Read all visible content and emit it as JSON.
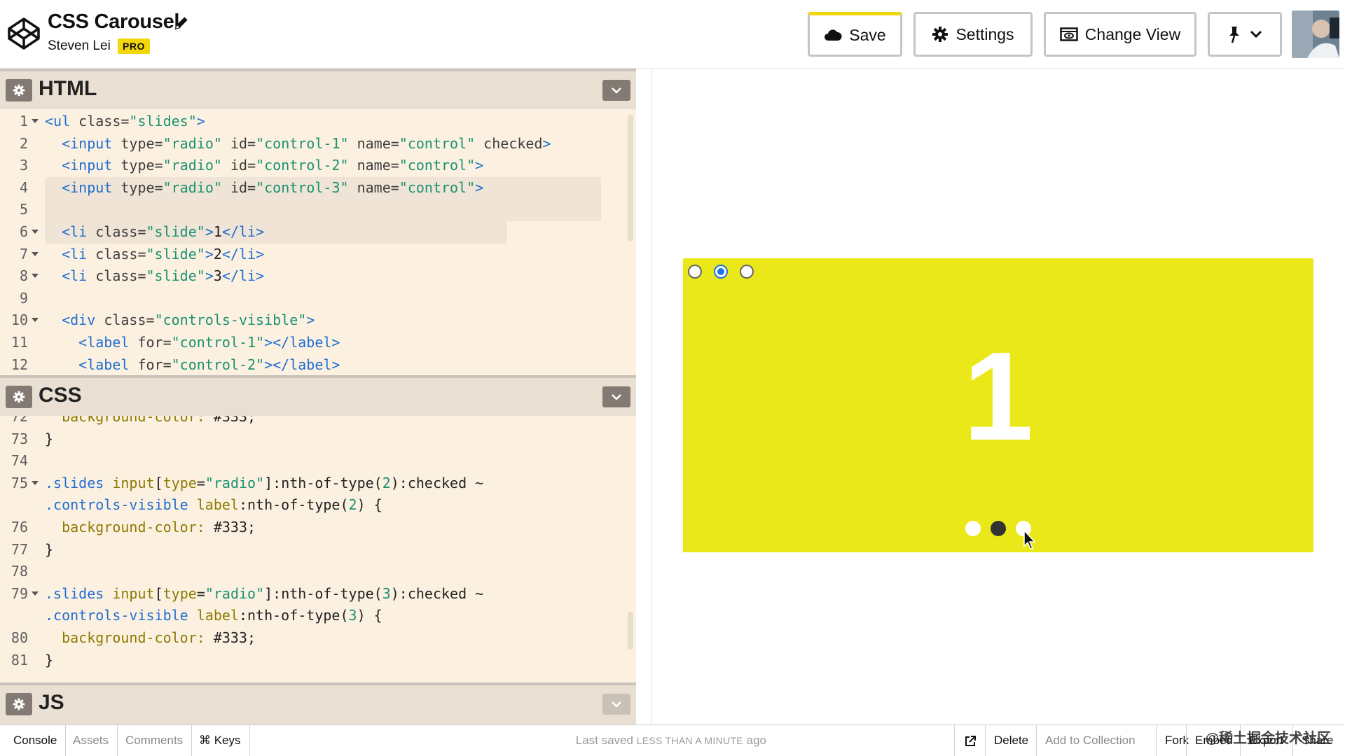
{
  "header": {
    "title": "CSS Carousel",
    "author": "Steven Lei",
    "badge": "PRO",
    "save_label": "Save",
    "settings_label": "Settings",
    "change_view_label": "Change View"
  },
  "panels": {
    "html": {
      "label": "HTML",
      "lines": [
        {
          "n": "1",
          "fold": true
        },
        {
          "n": "2",
          "fold": false
        },
        {
          "n": "3",
          "fold": false
        },
        {
          "n": "4",
          "fold": false
        },
        {
          "n": "5",
          "fold": false
        },
        {
          "n": "6",
          "fold": true
        },
        {
          "n": "7",
          "fold": true
        },
        {
          "n": "8",
          "fold": true
        },
        {
          "n": "9",
          "fold": false
        },
        {
          "n": "10",
          "fold": true
        },
        {
          "n": "11",
          "fold": false
        },
        {
          "n": "12",
          "fold": false
        }
      ]
    },
    "css": {
      "label": "CSS",
      "lines": [
        {
          "n": "72"
        },
        {
          "n": "73"
        },
        {
          "n": "74"
        },
        {
          "n": "75"
        },
        {
          "n": ""
        },
        {
          "n": "76"
        },
        {
          "n": "77"
        },
        {
          "n": "78"
        },
        {
          "n": "79"
        },
        {
          "n": ""
        },
        {
          "n": "80"
        },
        {
          "n": "81"
        }
      ]
    },
    "js": {
      "label": "JS"
    }
  },
  "preview": {
    "slide_text": "1",
    "radios": [
      {
        "checked": false
      },
      {
        "checked": true
      },
      {
        "checked": false
      }
    ],
    "dots": [
      {
        "active": false
      },
      {
        "active": true
      },
      {
        "active": false
      }
    ]
  },
  "footer": {
    "console": "Console",
    "assets": "Assets",
    "comments": "Comments",
    "keys": "⌘ Keys",
    "last_saved_prefix": "Last saved",
    "last_saved_caps": "LESS THAN A MINUTE",
    "last_saved_suffix": "ago",
    "delete": "Delete",
    "add_to_collection": "Add to Collection",
    "fork": "Fork",
    "embed": "Embed",
    "export": "Export",
    "share": "Share",
    "watermark": "@稀土掘金技术社区"
  }
}
